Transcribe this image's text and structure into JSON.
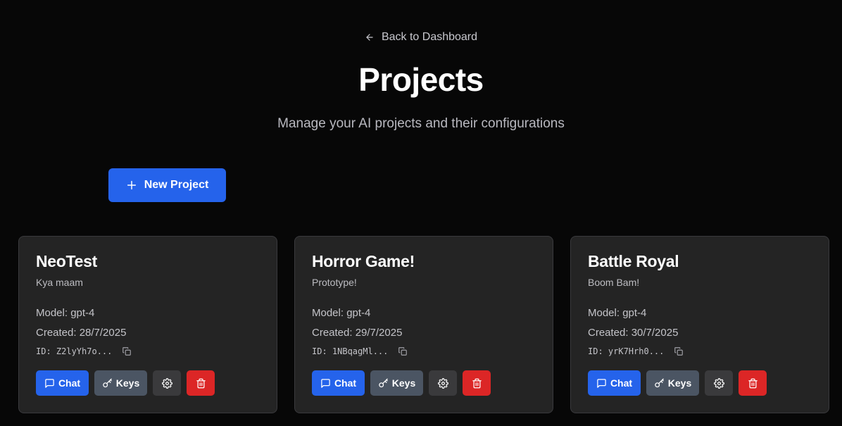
{
  "header": {
    "back_label": "Back to Dashboard",
    "title": "Projects",
    "subtitle": "Manage your AI projects and their configurations"
  },
  "toolbar": {
    "new_project_label": "New Project"
  },
  "projects": [
    {
      "name": "NeoTest",
      "description": "Kya maam",
      "model": "Model: gpt-4",
      "created": "Created: 28/7/2025",
      "id": "ID: Z2lyYh7o..."
    },
    {
      "name": "Horror Game!",
      "description": "Prototype!",
      "model": "Model: gpt-4",
      "created": "Created: 29/7/2025",
      "id": "ID: 1NBqagMl..."
    },
    {
      "name": "Battle Royal",
      "description": "Boom Bam!",
      "model": "Model: gpt-4",
      "created": "Created: 30/7/2025",
      "id": "ID: yrK7Hrh0..."
    }
  ],
  "card_actions": {
    "chat_label": "Chat",
    "keys_label": "Keys"
  },
  "icons": {
    "back": "arrow-left-icon",
    "new": "plus-icon",
    "copy": "copy-icon",
    "chat": "message-square-icon",
    "keys": "key-icon",
    "settings": "gear-icon",
    "delete": "trash-icon"
  },
  "colors": {
    "background": "#070707",
    "card": "#242424",
    "primary": "#2563eb",
    "secondary": "#4b5563",
    "danger": "#dc2626"
  }
}
